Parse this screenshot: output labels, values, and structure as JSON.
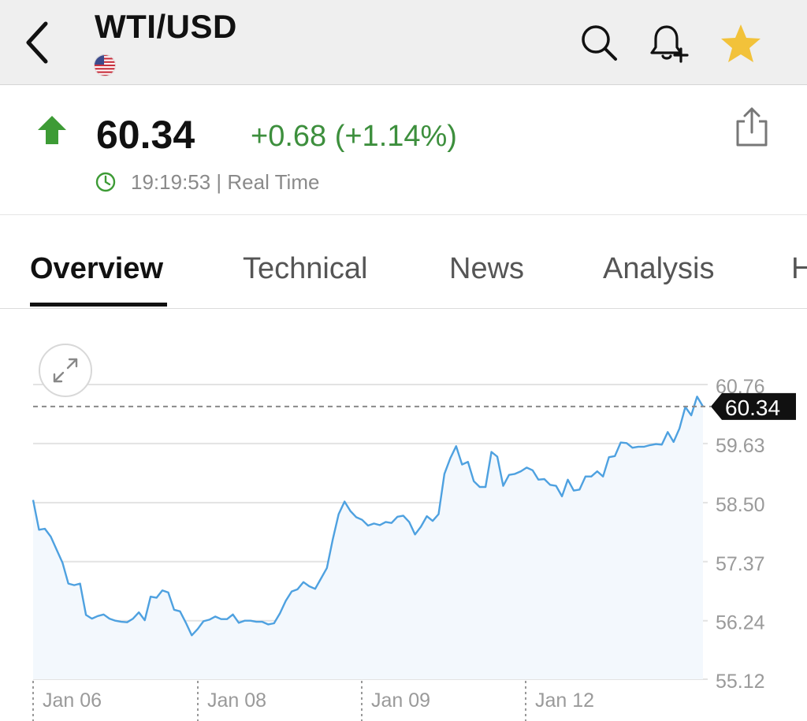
{
  "header": {
    "title": "WTI/USD",
    "flag_icon": "us-flag-icon",
    "icons": [
      "back-chevron-icon",
      "search-icon",
      "bell-plus-icon",
      "star-icon"
    ],
    "star_color": "#f2c23a"
  },
  "quote": {
    "price": "60.34",
    "change": "+0.68 (+1.14%)",
    "direction_icon": "up-arrow-icon",
    "timestamp": "19:19:53 | Real Time",
    "up_color": "#3d8f3d"
  },
  "tabs": [
    {
      "label": "Overview",
      "active": true
    },
    {
      "label": "Technical",
      "active": false
    },
    {
      "label": "News",
      "active": false
    },
    {
      "label": "Analysis",
      "active": false
    },
    {
      "label": "H",
      "active": false
    }
  ],
  "chart_data": {
    "type": "area",
    "title": "",
    "xlabel": "",
    "ylabel": "",
    "ylim": [
      55.12,
      60.76
    ],
    "yticks": [
      "60.76",
      "59.63",
      "58.50",
      "57.37",
      "56.24",
      "55.12"
    ],
    "xticks": [
      "Jan 06",
      "Jan 08",
      "Jan 09",
      "Jan 12"
    ],
    "current_value": "60.34",
    "line_color": "#4ea1e0",
    "series": [
      {
        "values": [
          58.55,
          57.98,
          58.0,
          57.85,
          57.6,
          57.35,
          56.95,
          56.92,
          56.95,
          56.35,
          56.28,
          56.33,
          56.36,
          56.28,
          56.24,
          56.22,
          56.21,
          56.28,
          56.4,
          56.25,
          56.7,
          56.68,
          56.82,
          56.78,
          56.45,
          56.42,
          56.2,
          55.96,
          56.08,
          56.23,
          56.26,
          56.32,
          56.27,
          56.27,
          56.36,
          56.2,
          56.24,
          56.24,
          56.22,
          56.22,
          56.17,
          56.19,
          56.38,
          56.62,
          56.8,
          56.84,
          56.98,
          56.9,
          56.85,
          57.05,
          57.25,
          57.8,
          58.28,
          58.52,
          58.34,
          58.22,
          58.17,
          58.06,
          58.1,
          58.07,
          58.13,
          58.11,
          58.23,
          58.25,
          58.13,
          57.89,
          58.04,
          58.24,
          58.15,
          58.28,
          59.05,
          59.35,
          59.58,
          59.23,
          59.28,
          58.91,
          58.8,
          58.8,
          59.47,
          59.38,
          58.82,
          59.03,
          59.05,
          59.1,
          59.17,
          59.12,
          58.94,
          58.95,
          58.84,
          58.82,
          58.62,
          58.94,
          58.73,
          58.75,
          59.0,
          59.0,
          59.1,
          59.0,
          59.37,
          59.39,
          59.65,
          59.64,
          59.55,
          59.57,
          59.57,
          59.6,
          59.62,
          59.61,
          59.85,
          59.66,
          59.92,
          60.33,
          60.17,
          60.53,
          60.34
        ]
      }
    ],
    "grid": true
  }
}
